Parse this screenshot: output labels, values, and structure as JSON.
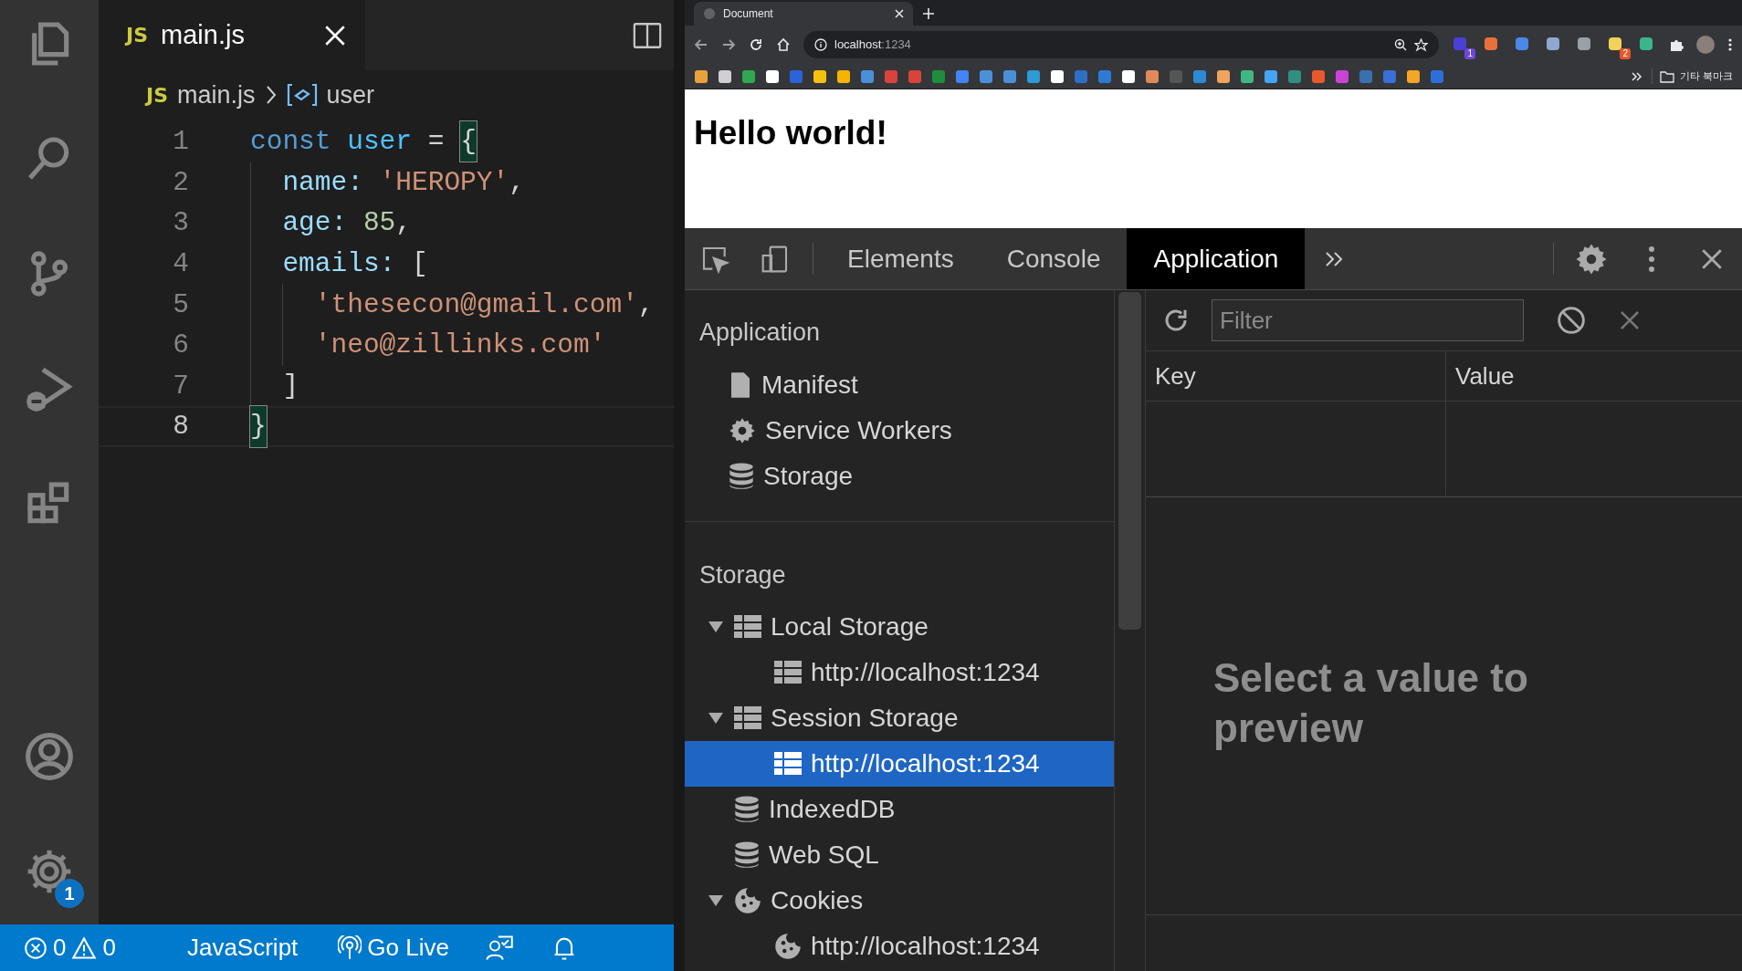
{
  "editor": {
    "activity_badge": "1",
    "tab": {
      "file_type": "JS",
      "label": "main.js"
    },
    "breadcrumb": {
      "file_type": "JS",
      "file": "main.js",
      "symbol": "user"
    },
    "lines": [
      {
        "number": "1",
        "current": false,
        "tokens": [
          {
            "kind": "keyword",
            "text": "const"
          },
          {
            "kind": "variable",
            "text": " user"
          },
          {
            "kind": "punct",
            "text": " = "
          },
          {
            "kind": "bracket_match",
            "text": "{"
          }
        ]
      },
      {
        "number": "2",
        "current": false,
        "tokens": [
          {
            "kind": "property",
            "text": "  name:"
          },
          {
            "kind": "string",
            "text": " 'HEROPY'"
          },
          {
            "kind": "punct",
            "text": ","
          }
        ]
      },
      {
        "number": "3",
        "current": false,
        "tokens": [
          {
            "kind": "property",
            "text": "  age:"
          },
          {
            "kind": "number",
            "text": " 85"
          },
          {
            "kind": "punct",
            "text": ","
          }
        ]
      },
      {
        "number": "4",
        "current": false,
        "tokens": [
          {
            "kind": "property",
            "text": "  emails:"
          },
          {
            "kind": "punct",
            "text": " ["
          }
        ]
      },
      {
        "number": "5",
        "current": false,
        "tokens": [
          {
            "kind": "string",
            "text": "    'thesecon@gmail.com'"
          },
          {
            "kind": "punct",
            "text": ","
          }
        ]
      },
      {
        "number": "6",
        "current": false,
        "tokens": [
          {
            "kind": "string",
            "text": "    'neo@zillinks.com'"
          }
        ]
      },
      {
        "number": "7",
        "current": false,
        "tokens": [
          {
            "kind": "punct",
            "text": "  ]"
          }
        ]
      },
      {
        "number": "8",
        "current": true,
        "tokens": [
          {
            "kind": "bracket_match",
            "text": "}"
          }
        ]
      }
    ]
  },
  "status_bar": {
    "errors": "0",
    "warnings": "0",
    "language": "JavaScript",
    "go_live": "Go Live"
  },
  "browser": {
    "tab_title": "Document",
    "url": {
      "host": "localhost",
      "port": ":1234"
    },
    "extension_badges": [
      "1",
      "2"
    ],
    "bookmark_folder": "기타 북마크",
    "page_heading": "Hello world!"
  },
  "devtools": {
    "tabs": [
      {
        "label": "Elements",
        "selected": false
      },
      {
        "label": "Console",
        "selected": false
      },
      {
        "label": "Application",
        "selected": true
      }
    ],
    "sidebar": [
      {
        "title": "Application",
        "items": [
          {
            "kind": "file",
            "label": "Manifest",
            "selected": false
          },
          {
            "kind": "gear",
            "label": "Service Workers",
            "selected": false
          },
          {
            "kind": "database",
            "label": "Storage",
            "selected": false
          }
        ]
      },
      {
        "title": "Storage",
        "items": [
          {
            "kind": "grid",
            "label": "Local Storage",
            "selected": false,
            "expanded": true,
            "children": [
              {
                "kind": "grid",
                "label": "http://localhost:1234",
                "selected": false
              }
            ]
          },
          {
            "kind": "grid",
            "label": "Session Storage",
            "selected": false,
            "expanded": true,
            "children": [
              {
                "kind": "grid",
                "label": "http://localhost:1234",
                "selected": true
              }
            ]
          },
          {
            "kind": "database",
            "label": "IndexedDB",
            "selected": false
          },
          {
            "kind": "database",
            "label": "Web SQL",
            "selected": false
          },
          {
            "kind": "cookie",
            "label": "Cookies",
            "selected": false,
            "expanded": true,
            "children": [
              {
                "kind": "cookie",
                "label": "http://localhost:1234",
                "selected": false
              }
            ]
          }
        ]
      }
    ],
    "filter": {
      "placeholder": "Filter"
    },
    "table": {
      "columns": [
        "Key",
        "Value"
      ]
    },
    "preview_message": "Select a value to preview"
  }
}
